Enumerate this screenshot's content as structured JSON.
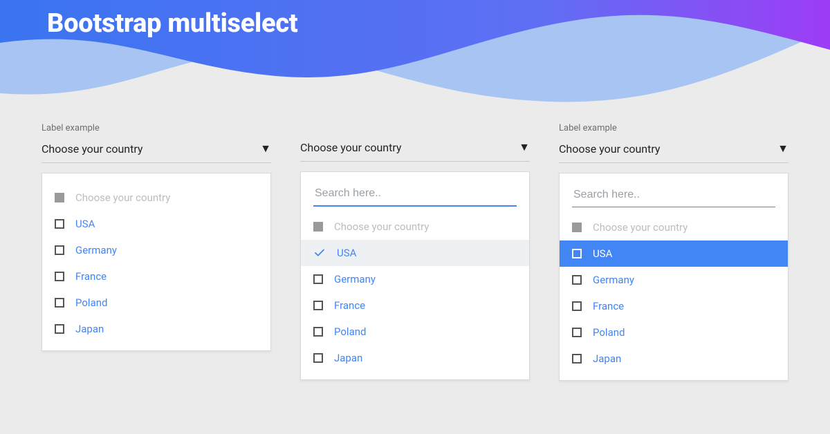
{
  "page_title": "Bootstrap multiselect",
  "label_text": "Label example",
  "select_prompt": "Choose your country",
  "search_placeholder": "Search here..",
  "header_option": "Choose your country",
  "countries": [
    "USA",
    "Germany",
    "France",
    "Poland",
    "Japan"
  ],
  "colors": {
    "accent": "#4285f4",
    "header_gradient_start": "#3a74f0",
    "header_gradient_end": "#9d3cf5"
  },
  "panels": {
    "a": {
      "has_label": true,
      "has_search": false,
      "show_header_opt": true,
      "highlight_index": null,
      "active_index": null
    },
    "b": {
      "has_label": false,
      "has_search": true,
      "show_header_opt": true,
      "highlight_index": 0,
      "active_index": null,
      "search_thin": false
    },
    "c": {
      "has_label": true,
      "has_search": true,
      "show_header_opt": true,
      "highlight_index": null,
      "active_index": 0,
      "search_thin": true
    }
  }
}
